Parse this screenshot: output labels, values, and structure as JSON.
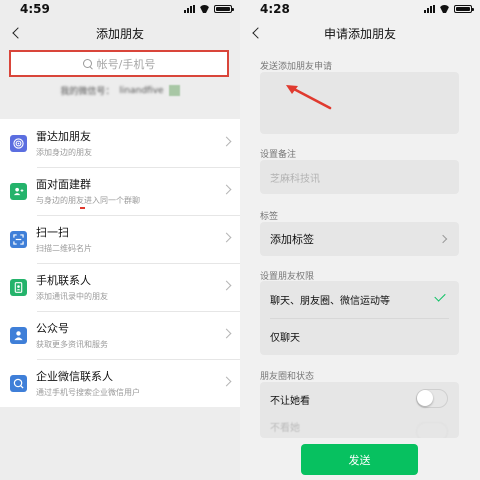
{
  "left": {
    "status": {
      "time": "4:59"
    },
    "nav": {
      "title": "添加朋友"
    },
    "search": {
      "placeholder": "帐号/手机号",
      "highlight_color": "#d9453a"
    },
    "my_wechat": {
      "label": "我的微信号：",
      "value": "linandfive"
    },
    "items": [
      {
        "title": "雷达加朋友",
        "subtitle": "添加身边的朋友",
        "icon": "radar-icon",
        "color": "#5b6ee0"
      },
      {
        "title": "面对面建群",
        "subtitle": "与身边的朋友进入同一个群聊",
        "icon": "group-face-icon",
        "color": "#24b36b"
      },
      {
        "title": "扫一扫",
        "subtitle": "扫描二维码名片",
        "icon": "scan-icon",
        "color": "#3f7fd8"
      },
      {
        "title": "手机联系人",
        "subtitle": "添加通讯录中的朋友",
        "icon": "phone-contact-icon",
        "color": "#24b36b"
      },
      {
        "title": "公众号",
        "subtitle": "获取更多资讯和服务",
        "icon": "official-account-icon",
        "color": "#3f7fd8"
      },
      {
        "title": "企业微信联系人",
        "subtitle": "通过手机号搜索企业微信用户",
        "icon": "work-wechat-icon",
        "color": "#3f7fd8"
      }
    ]
  },
  "right": {
    "status": {
      "time": "4:28"
    },
    "nav": {
      "title": "申请添加朋友"
    },
    "request_label": "发送添加朋友申请",
    "remark_label": "设置备注",
    "remark_value": "芝麻科技讯",
    "tags_label": "标签",
    "tags_row": "添加标签",
    "permissions_label": "设置朋友权限",
    "permissions": [
      {
        "label": "聊天、朋友圈、微信运动等",
        "selected": true
      },
      {
        "label": "仅聊天",
        "selected": false
      }
    ],
    "moments_label": "朋友圈和状态",
    "moments_rows": [
      "不让她看",
      "不看她"
    ],
    "send_label": "发送",
    "accent_color": "#07c160"
  }
}
